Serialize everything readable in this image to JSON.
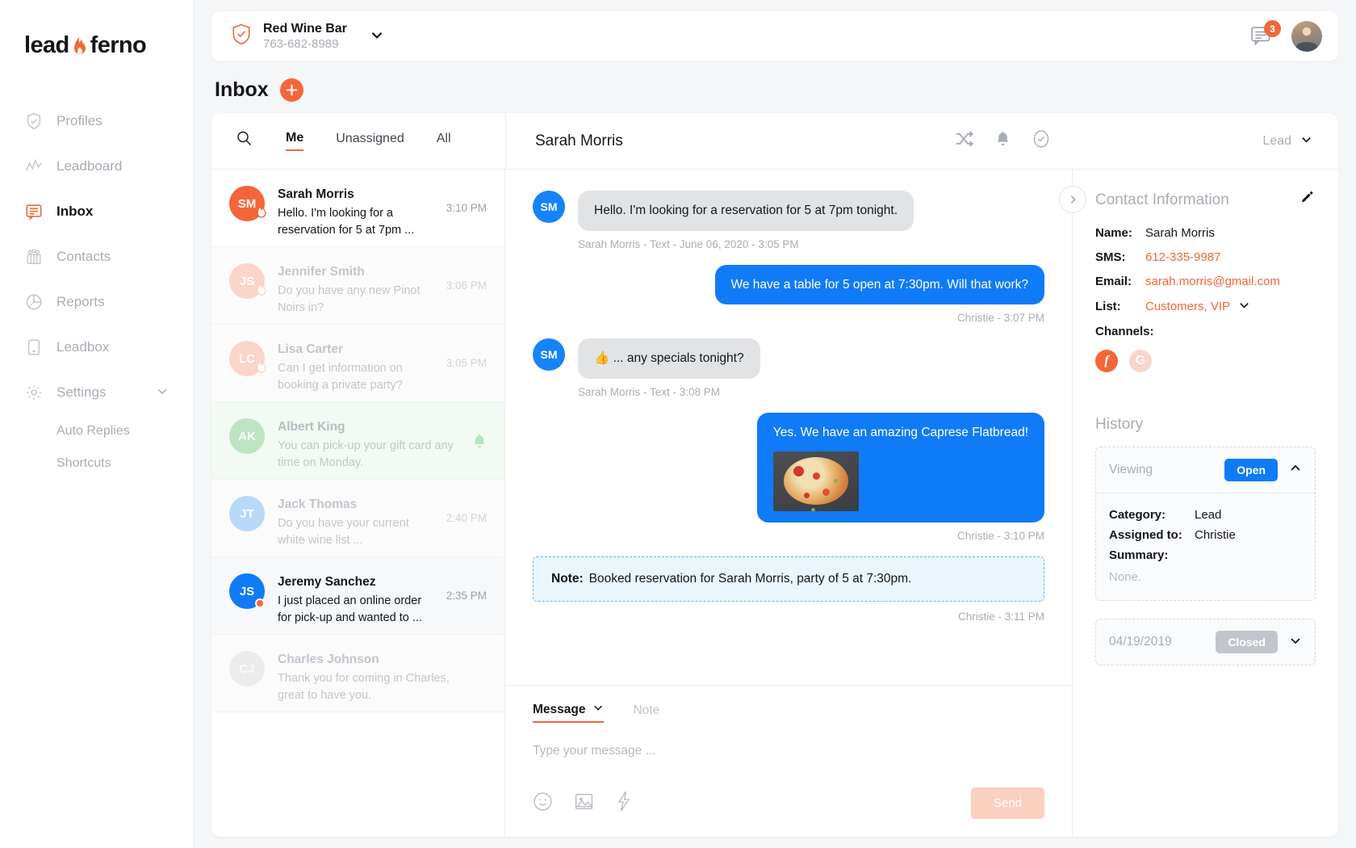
{
  "brand": {
    "name_part1": "lead",
    "name_part2": "ferno",
    "accent": "#f4663a"
  },
  "sidebar": {
    "items": [
      {
        "label": "Profiles",
        "icon": "shield-check-icon"
      },
      {
        "label": "Leadboard",
        "icon": "chart-line-icon"
      },
      {
        "label": "Inbox",
        "icon": "chat-icon"
      },
      {
        "label": "Contacts",
        "icon": "people-icon"
      },
      {
        "label": "Reports",
        "icon": "pie-chart-icon"
      },
      {
        "label": "Leadbox",
        "icon": "phone-icon"
      },
      {
        "label": "Settings",
        "icon": "gear-icon"
      }
    ],
    "sub_items": [
      {
        "label": "Auto Replies"
      },
      {
        "label": "Shortcuts"
      }
    ]
  },
  "topbar": {
    "business_name": "Red Wine Bar",
    "business_phone": "763-682-8989",
    "message_badge": "3"
  },
  "page": {
    "title": "Inbox",
    "add_label": "+"
  },
  "tabs": [
    {
      "label": "Me",
      "active": true
    },
    {
      "label": "Unassigned",
      "active": false
    },
    {
      "label": "All",
      "active": false
    }
  ],
  "conversation_header": {
    "name": "Sarah Morris",
    "status_label": "Lead",
    "icons": [
      "shuffle-icon",
      "bell-icon",
      "check-circle-icon"
    ]
  },
  "conversations": [
    {
      "name": "Sarah Morris",
      "preview": "Hello. I'm looking for a reservation for 5 at 7pm ...",
      "time": "3:10 PM",
      "initials": "SM",
      "color": "#f4663a",
      "state": "selected",
      "flame": true
    },
    {
      "name": "Jennifer Smith",
      "preview": "Do you have any new Pinot Noirs in?",
      "time": "3:06 PM",
      "initials": "JS",
      "color": "#fbd5c9",
      "state": "dim",
      "flame": true
    },
    {
      "name": "Lisa Carter",
      "preview": "Can I get information on booking a private party?",
      "time": "3:05 PM",
      "initials": "LC",
      "color": "#fbd5c9",
      "state": "dim",
      "flame": true
    },
    {
      "name": "Albert King",
      "preview": "You can pick-up your gift card any time on Monday.",
      "time": "",
      "initials": "AK",
      "color": "#bde5c2",
      "state": "green",
      "bell": true
    },
    {
      "name": "Jack Thomas",
      "preview": "Do you have your current white wine list ...",
      "time": "2:40 PM",
      "initials": "JT",
      "color": "#b8daf8",
      "state": "dim"
    },
    {
      "name": "Jeremy Sanchez",
      "preview": "I just placed an online order for pick-up and wanted to ...",
      "time": "2:35 PM",
      "initials": "JS",
      "color": "#107bf7",
      "state": "unread",
      "dot": true
    },
    {
      "name": "Charles Johnson",
      "preview": "Thank you for coming in Charles, great to have you.",
      "time": "",
      "initials": "CJ",
      "color": "#ececed",
      "state": "dim"
    }
  ],
  "messages": [
    {
      "dir": "in",
      "initials": "SM",
      "text": "Hello. I'm looking for a reservation for 5 at 7pm tonight.",
      "meta": "Sarah Morris - Text - June 06, 2020 - 3:05 PM"
    },
    {
      "dir": "out",
      "text": "We have a table for 5 open at 7:30pm. Will that work?",
      "meta": "Christie - 3:07 PM"
    },
    {
      "dir": "in",
      "initials": "SM",
      "text": "👍 ... any specials tonight?",
      "meta": "Sarah Morris - Text - 3:08 PM"
    },
    {
      "dir": "out",
      "text": "Yes. We have an amazing Caprese Flatbread!",
      "meta": "Christie - 3:10 PM",
      "image": "caprese-flatbread-photo"
    }
  ],
  "note": {
    "label": "Note:",
    "text": "Booked reservation for Sarah Morris, party of 5 at 7:30pm.",
    "meta": "Christie - 3:11 PM"
  },
  "composer": {
    "tabs": [
      {
        "label": "Message",
        "active": true
      },
      {
        "label": "Note",
        "active": false
      }
    ],
    "placeholder": "Type your message ...",
    "tools": [
      "emoji-icon",
      "image-icon",
      "lightning-icon"
    ],
    "send_label": "Send"
  },
  "contact": {
    "title": "Contact Information",
    "fields": [
      {
        "label": "Name:",
        "value": "Sarah Morris",
        "link": false
      },
      {
        "label": "SMS:",
        "value": "612-335-9987",
        "link": true
      },
      {
        "label": "Email:",
        "value": "sarah.morris@gmail.com",
        "link": true
      },
      {
        "label": "List:",
        "value": "Customers, VIP",
        "link": true,
        "chevron": true
      }
    ],
    "channels_label": "Channels:",
    "channels": [
      {
        "name": "facebook-icon",
        "glyph": "f"
      },
      {
        "name": "google-icon",
        "glyph": "G"
      }
    ]
  },
  "history": {
    "title": "History",
    "current": {
      "label": "Viewing",
      "status": "Open",
      "rows": [
        {
          "key": "Category:",
          "value": "Lead"
        },
        {
          "key": "Assigned to:",
          "value": "Christie"
        },
        {
          "key": "Summary:",
          "value": ""
        }
      ],
      "summary_empty": "None."
    },
    "past": {
      "date": "04/19/2019",
      "status": "Closed"
    }
  }
}
